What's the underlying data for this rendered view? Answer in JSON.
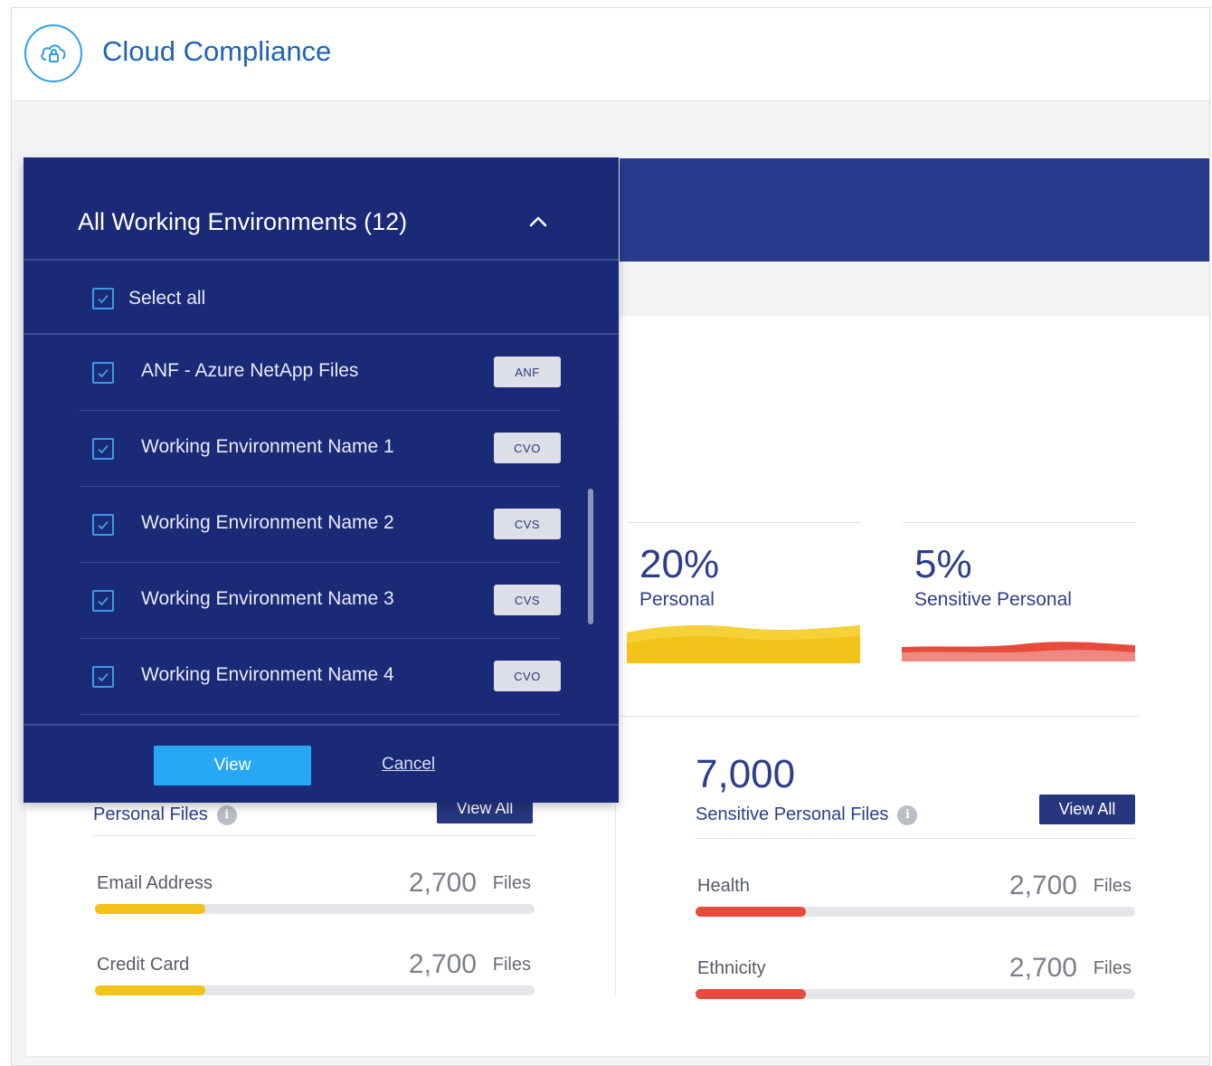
{
  "app": {
    "title": "Cloud Compliance",
    "logo_icon": "cloud-lock-icon"
  },
  "dropdown": {
    "title": "All Working Environments (12)",
    "select_all_label": "Select all",
    "items": [
      {
        "label": "ANF - Azure NetApp Files",
        "tag": "ANF",
        "checked": true
      },
      {
        "label": "Working Environment Name 1",
        "tag": "CVO",
        "checked": true
      },
      {
        "label": "Working Environment Name 2",
        "tag": "CVS",
        "checked": true
      },
      {
        "label": "Working Environment Name 3",
        "tag": "CVS",
        "checked": true
      },
      {
        "label": "Working Environment Name 4",
        "tag": "CVO",
        "checked": true
      }
    ],
    "view_label": "View",
    "cancel_label": "Cancel"
  },
  "stats": {
    "personal": {
      "percent": "20%",
      "label": "Personal",
      "color": "#f2c318"
    },
    "sensitive": {
      "percent": "5%",
      "label": "Sensitive Personal",
      "color": "#e84a3d"
    }
  },
  "personal_files": {
    "title": "Personal Files",
    "view_all": "View All",
    "categories": [
      {
        "label": "Email Address",
        "count": "2,700",
        "unit": "Files",
        "fill": 0.25
      },
      {
        "label": "Credit Card",
        "count": "2,700",
        "unit": "Files",
        "fill": 0.25
      }
    ]
  },
  "sensitive_files": {
    "total": "7,000",
    "title": "Sensitive Personal Files",
    "view_all": "View All",
    "categories": [
      {
        "label": "Health",
        "count": "2,700",
        "unit": "Files",
        "fill": 0.25
      },
      {
        "label": "Ethnicity",
        "count": "2,700",
        "unit": "Files",
        "fill": 0.25
      }
    ]
  },
  "colors": {
    "navy": "#1b2a77",
    "accent": "#27a7f4",
    "yellow": "#f2c318",
    "red": "#e84a3d"
  }
}
